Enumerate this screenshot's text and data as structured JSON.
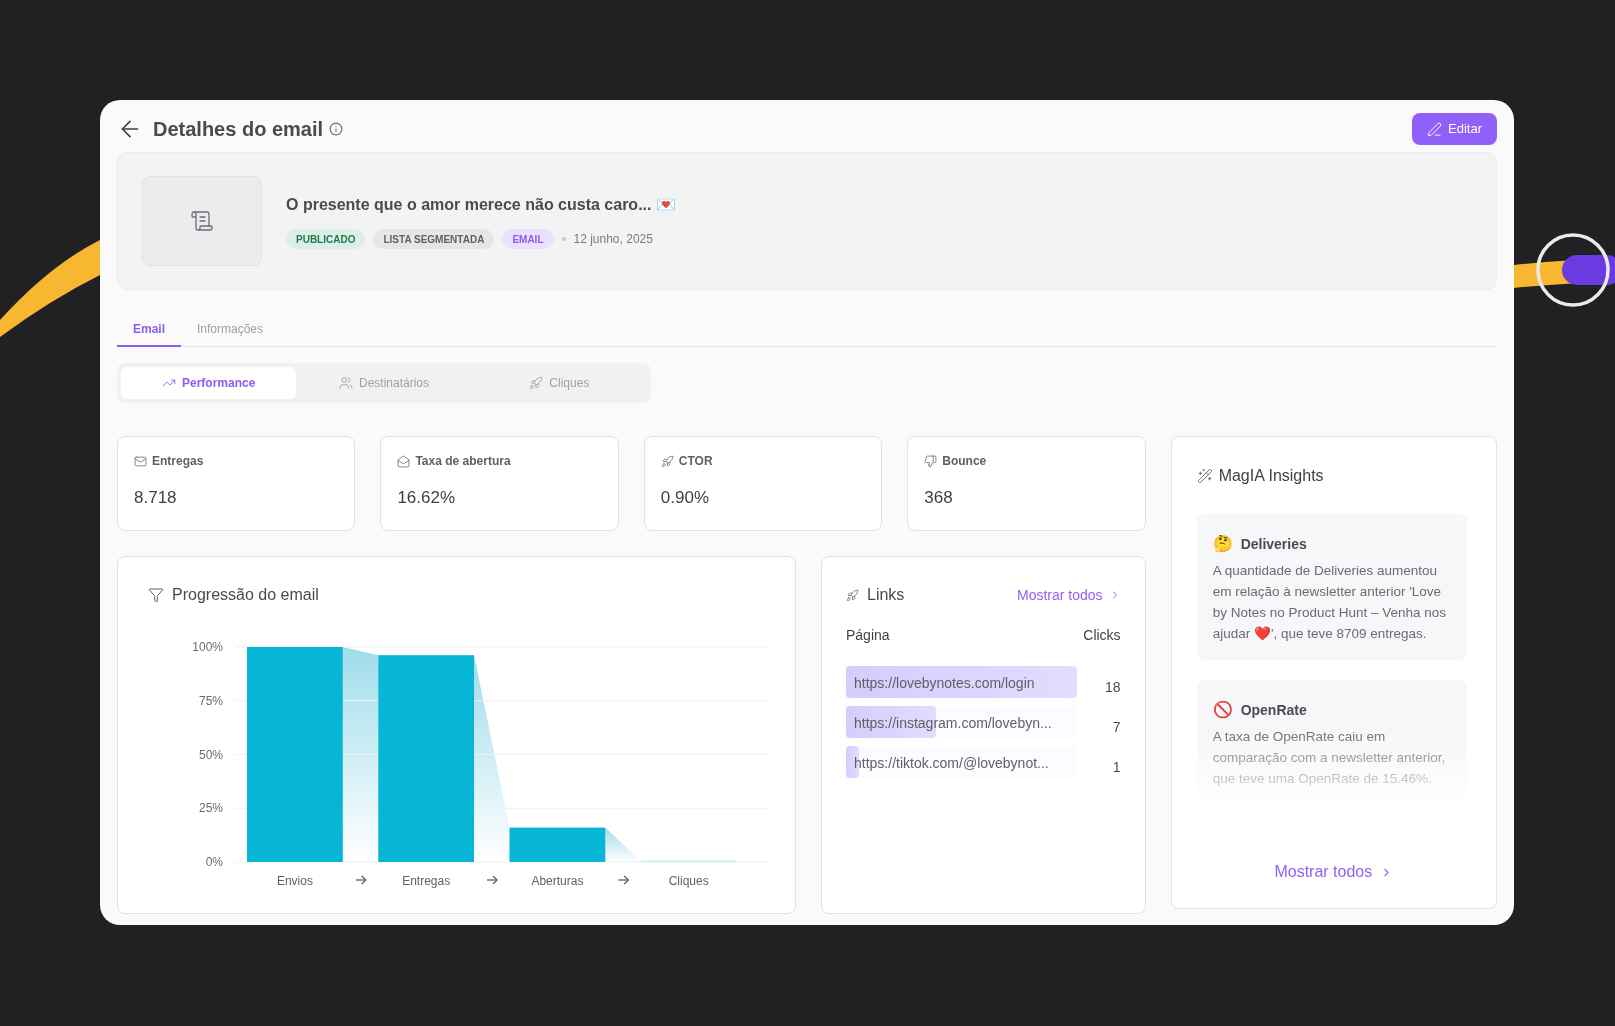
{
  "header": {
    "title": "Detalhes do email",
    "edit_button": "Editar"
  },
  "email": {
    "subject": "O presente que o amor merece não custa caro... 💌",
    "date": "12 junho, 2025",
    "tags": [
      {
        "label": "PUBLICADO",
        "color": "#1f7a4d"
      },
      {
        "label": "LISTA SEGMENTADA",
        "color": "#5f5f66"
      },
      {
        "label": "EMAIL",
        "color": "#8b5cf6"
      }
    ]
  },
  "tabs": [
    {
      "label": "Email",
      "selected": true
    },
    {
      "label": "Informações",
      "selected": false
    }
  ],
  "subtabs": [
    {
      "label": "Performance",
      "selected": true
    },
    {
      "label": "Destinatários",
      "selected": false
    },
    {
      "label": "Cliques",
      "selected": false
    }
  ],
  "stats": [
    {
      "label": "Entregas",
      "value": "8.718"
    },
    {
      "label": "Taxa de abertura",
      "value": "16.62%"
    },
    {
      "label": "CTOR",
      "value": "0.90%"
    },
    {
      "label": "Bounce",
      "value": "368"
    }
  ],
  "progression": {
    "title": "Progressão do email",
    "chart_data": {
      "type": "bar",
      "categories": [
        "Envios",
        "Entregas",
        "Aberturas",
        "Cliques"
      ],
      "series": [
        {
          "color": "#06b6d4",
          "values": [
            100,
            96.2,
            16,
            0.3
          ]
        }
      ],
      "grid": true,
      "ylim": [
        0,
        100
      ],
      "yticks": [
        {
          "value": 0,
          "label": "0%"
        },
        {
          "value": 25,
          "label": "25%"
        },
        {
          "value": 50,
          "label": "50%"
        },
        {
          "value": 75,
          "label": "75%"
        },
        {
          "value": 100,
          "label": "100%"
        }
      ]
    }
  },
  "links": {
    "title": "Links",
    "show_all": "Mostrar todos",
    "columns": [
      "Página",
      "Clicks"
    ],
    "rows": [
      {
        "url": "https://lovebynotes.com/login",
        "clicks": "18",
        "level": 1
      },
      {
        "url": "https://instagram.com/lovebyn...",
        "clicks": "7",
        "level": 0.39
      },
      {
        "url": "https://tiktok.com/@lovebynot...",
        "clicks": "1",
        "level": 0.056
      }
    ]
  },
  "insights": {
    "title": "MagIA Insights",
    "show_all": "Mostrar todos",
    "items": [
      {
        "emoji": "🤔",
        "title": "Deliveries",
        "text": "A quantidade de Deliveries aumentou em relação à newsletter anterior 'Love by Notes no Product Hunt – Venha nos ajudar ❤️', que teve 8709 entregas.",
        "faded": false
      },
      {
        "emoji": "🚫",
        "title": "OpenRate",
        "text": "A taxa de OpenRate caiu em comparação com a newsletter anterior, que teve uma OpenRate de 15.46%.",
        "faded": true
      }
    ]
  }
}
